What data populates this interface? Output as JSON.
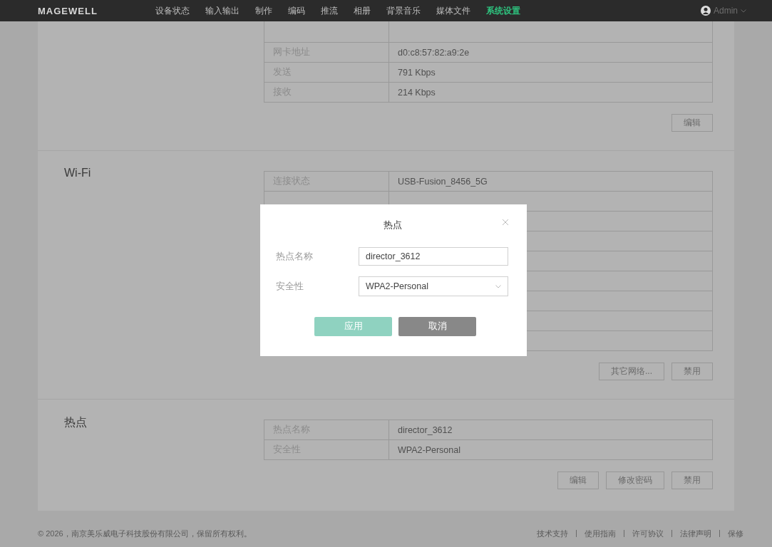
{
  "nav": {
    "logo": "MAGEWELL",
    "items": [
      {
        "label": "设备状态",
        "selected": false
      },
      {
        "label": "输入输出",
        "selected": false
      },
      {
        "label": "制作",
        "selected": false
      },
      {
        "label": "编码",
        "selected": false
      },
      {
        "label": "推流",
        "selected": false
      },
      {
        "label": "相册",
        "selected": false
      },
      {
        "label": "背景音乐",
        "selected": false
      },
      {
        "label": "媒体文件",
        "selected": false
      },
      {
        "label": "系统设置",
        "selected": true
      }
    ],
    "user": "Admin"
  },
  "sections": [
    {
      "rows": [
        {
          "label": "网卡地址",
          "value": "d0:c8:57:82:a9:2e"
        },
        {
          "label": "发送",
          "value": "791 Kbps"
        },
        {
          "label": "接收",
          "value": "214 Kbps"
        }
      ],
      "buttons": [
        "编辑"
      ]
    },
    {
      "title": "Wi-Fi",
      "rows": [
        {
          "label": "连接状态",
          "value": "USB-Fusion_8456_5G"
        }
      ],
      "buttons": [
        "其它网络...",
        "禁用"
      ]
    },
    {
      "title": "热点",
      "rows": [
        {
          "label": "热点名称",
          "value": "director_3612"
        },
        {
          "label": "安全性",
          "value": "WPA2-Personal"
        }
      ],
      "buttons": [
        "编辑",
        "修改密码",
        "禁用"
      ]
    }
  ],
  "dialog": {
    "title": "热点",
    "fields": [
      {
        "kind": "input",
        "label": "热点名称",
        "value": "director_3612"
      },
      {
        "kind": "select",
        "label": "安全性",
        "value": "WPA2-Personal"
      }
    ],
    "buttons": [
      {
        "label": "应用",
        "kind": "primary",
        "disabled": true
      },
      {
        "label": "取消",
        "kind": "secondary",
        "disabled": false
      }
    ]
  },
  "footer": {
    "copyright": "© 2026，南京美乐威电子科技股份有限公司，保留所有权利。",
    "links": [
      "技术支持",
      "使用指南",
      "许可协议",
      "法律声明",
      "保修"
    ]
  }
}
